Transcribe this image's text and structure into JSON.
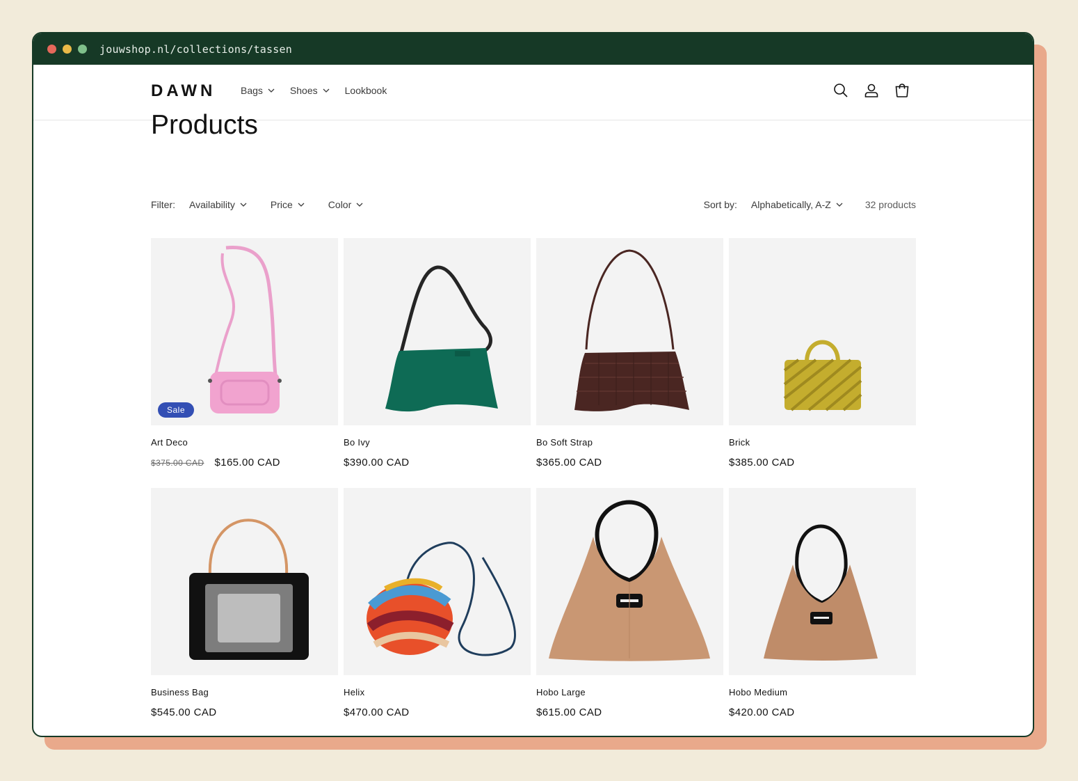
{
  "browser": {
    "url": "jouwshop.nl/collections/tassen",
    "dots": [
      "#e5685b",
      "#e9b948",
      "#7fc08b"
    ]
  },
  "header": {
    "logo": "DAWN",
    "nav": [
      {
        "label": "Bags",
        "dropdown": true
      },
      {
        "label": "Shoes",
        "dropdown": true
      },
      {
        "label": "Lookbook",
        "dropdown": false
      }
    ],
    "icons": [
      "search-icon",
      "account-icon",
      "cart-icon"
    ]
  },
  "page": {
    "title": "Products"
  },
  "filters": {
    "label": "Filter:",
    "facets": [
      "Availability",
      "Price",
      "Color"
    ],
    "sort_label": "Sort by:",
    "sort_value": "Alphabetically, A-Z",
    "count": "32 products"
  },
  "products": [
    {
      "title": "Art Deco",
      "compare_price": "$375.00 CAD",
      "price": "$165.00 CAD",
      "badge": "Sale",
      "color": "#f1a3cf"
    },
    {
      "title": "Bo Ivy",
      "price": "$390.00 CAD",
      "color": "#0e6b55"
    },
    {
      "title": "Bo Soft Strap",
      "price": "$365.00 CAD",
      "color": "#4a2622"
    },
    {
      "title": "Brick",
      "price": "$385.00 CAD",
      "color": "#c4ad2e"
    },
    {
      "title": "Business Bag",
      "price": "$545.00 CAD",
      "color": "#111111"
    },
    {
      "title": "Helix",
      "price": "$470.00 CAD",
      "color": "#e8502a"
    },
    {
      "title": "Hobo Large",
      "price": "$615.00 CAD",
      "color": "#c99773"
    },
    {
      "title": "Hobo Medium",
      "price": "$420.00 CAD",
      "color": "#bf8c69"
    }
  ],
  "colors": {
    "browser_chrome": "#163926",
    "background": "#f2ebda",
    "shadow": "#e9a98b",
    "sale_badge": "#334fb4"
  }
}
